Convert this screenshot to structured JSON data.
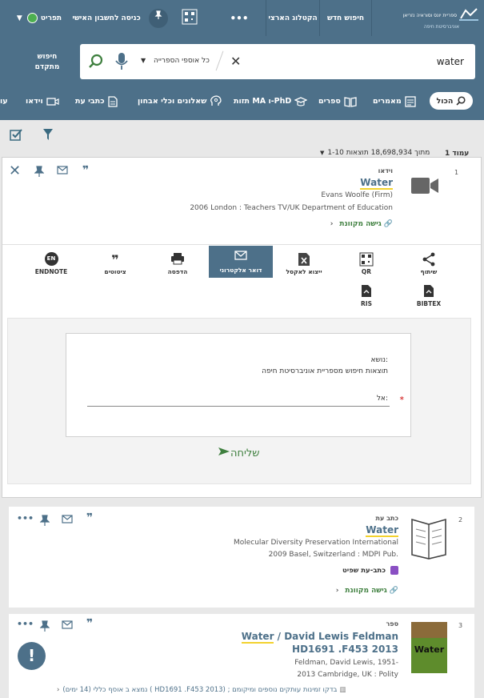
{
  "header": {
    "logo_text": "ספריית יונס וסוראיה נזריאן",
    "logo_sub": "אוניברסיטת חיפה",
    "new_search": "חיפוש חדש",
    "national_catalog": "הקטלוג הארצי",
    "more": "•••",
    "login": "כניסה לחשבון האישי",
    "menu": "תפריט"
  },
  "search": {
    "query": "water",
    "scope": "כל אוספי הספרייה",
    "advanced_line1": "חיפוש",
    "advanced_line2": "מתקדם"
  },
  "tabs": [
    {
      "label": "הכול"
    },
    {
      "label": "מאמרים"
    },
    {
      "label": "ספרים"
    },
    {
      "label": "תזות MA ו-PhD"
    },
    {
      "label": "שאלונים וכלי אבחון"
    },
    {
      "label": "כתבי עת"
    },
    {
      "label": "וידאו"
    },
    {
      "label": "עו"
    }
  ],
  "results_summary": {
    "page": "עמוד 1",
    "range": "1-10 מתוך 18,698,934 תוצאות"
  },
  "result1": {
    "index": "1",
    "type": "וידאו",
    "title": "Water",
    "author": "Evans Woolfe (Firm)",
    "publisher": "2006 London : Teachers TV/UK Department of Education",
    "access": "גישה מקוונת"
  },
  "send_actions": [
    {
      "label": "שיתוף",
      "icon": "share-icon"
    },
    {
      "label": "QR",
      "icon": "qr-icon"
    },
    {
      "label": "ייצוא לאקסל",
      "icon": "excel-icon"
    },
    {
      "label": "דואר אלקטרוני",
      "icon": "mail-icon"
    },
    {
      "label": "הדפסה",
      "icon": "print-icon"
    },
    {
      "label": "ציטוטים",
      "icon": "quote-icon"
    },
    {
      "label": "ENDNOTE",
      "icon": "endnote-icon"
    },
    {
      "label": "BIBTEX",
      "icon": "file-icon"
    },
    {
      "label": "RIS",
      "icon": "file-icon"
    }
  ],
  "email_form": {
    "subject_label": "נושא:",
    "subject_value": "תוצאות חיפוש מספריית אוניברסיטת חיפה",
    "to_label": "אל:",
    "required_mark": "*",
    "send": "שליחה"
  },
  "result2": {
    "index": "2",
    "type": "כתב עת",
    "title": "Water",
    "publisher1": "Molecular Diversity Preservation International",
    "publisher2": "2009 Basel, Switzerland : MDPI Pub.",
    "peer_reviewed": "כתב-עת שפיט",
    "access": "גישה מקוונת"
  },
  "result3": {
    "index": "3",
    "type": "ספר",
    "title_prefix": "Water",
    "title_rest": " / David Lewis Feldman",
    "callno": "HD1691 .F453 2013",
    "author": "Feldman, David Lewis, 1951-",
    "publisher": "2013 Cambridge, UK : Polity",
    "location": "נמצא ב  אוסף כללי (14 ימים)  ( HD1691 .F453 2013) ; בדקו זמינות עותקים נוספים ומיקומם",
    "cover_text": "Water"
  },
  "colors": {
    "header": "#4d7089",
    "accent_green": "#3e7f3e",
    "active_button": "#4d7089",
    "highlight": "#f2d22e"
  }
}
